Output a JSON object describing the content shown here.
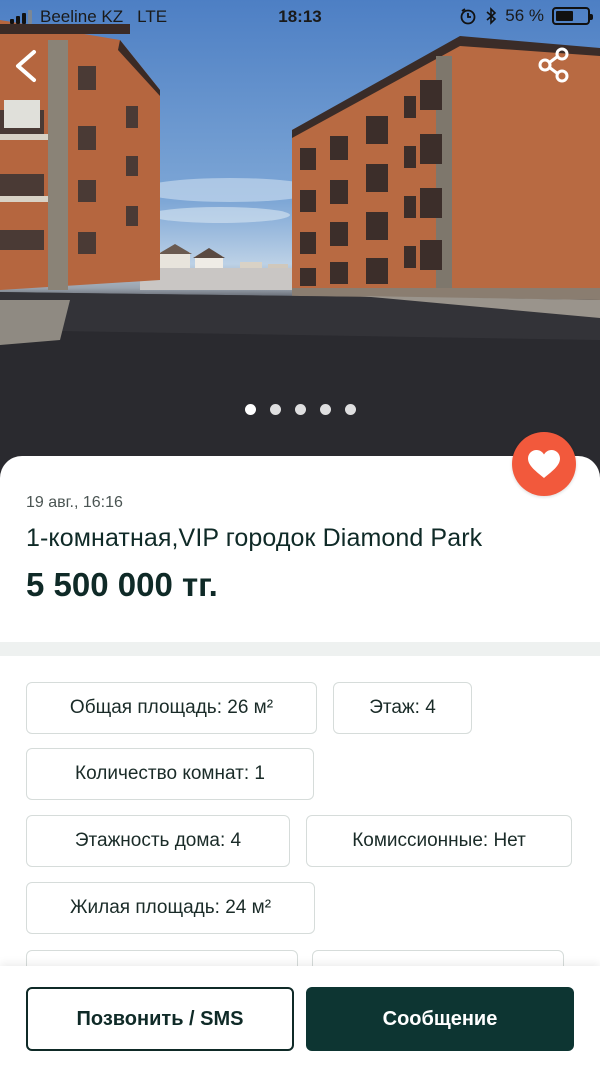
{
  "status_bar": {
    "carrier": "Beeline KZ",
    "network": "LTE",
    "time": "18:13",
    "battery": "56 %",
    "battery_level": 0.56
  },
  "gallery": {
    "image_count": 5,
    "active_index": 0
  },
  "listing": {
    "date": "19 авг., 16:16",
    "title": "1-комнатная,VIP  городок Diamond Park",
    "price": "5 500 000 тг."
  },
  "characteristics": [
    "Общая площадь: 26 м²",
    "Этаж: 4",
    "Количество комнат: 1",
    "Этажность дома: 4",
    "Комиссионные: Нет",
    "Жилая площадь: 24 м²"
  ],
  "actions": {
    "call_label": "Позвонить / SMS",
    "message_label": "Сообщение"
  },
  "colors": {
    "accent": "#f2593c",
    "primary": "#0d3532",
    "text": "#0f2a27"
  },
  "icons": [
    "back-arrow-icon",
    "share-icon",
    "heart-icon",
    "signal-icon",
    "bluetooth-icon",
    "alarm-icon",
    "battery-icon"
  ]
}
